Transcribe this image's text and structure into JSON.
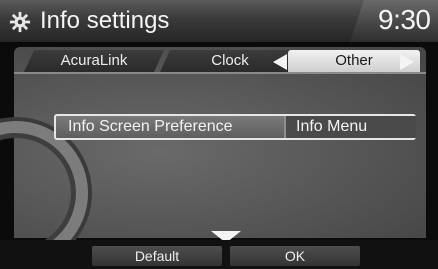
{
  "header": {
    "title": "Info settings",
    "title_icon": "gear-icon",
    "time": "9:30"
  },
  "tabs": [
    {
      "label": "AcuraLink",
      "selected": false
    },
    {
      "label": "Clock",
      "selected": false
    },
    {
      "label": "Other",
      "selected": true
    }
  ],
  "tab_arrows": {
    "left_icon": "arrow-left-icon",
    "right_icon": "arrow-right-icon"
  },
  "setting": {
    "label": "Info Screen Preference",
    "value": "Info Menu"
  },
  "scroll_indicator": "chevron-down-icon",
  "softkeys": {
    "default_label": "Default",
    "ok_label": "OK"
  },
  "colors": {
    "text": "#f4f4f4",
    "selected_tab_bg": "#e8e8e8",
    "panel_bg": "#5a5a5a",
    "screen_bg": "#0b0b0b"
  }
}
